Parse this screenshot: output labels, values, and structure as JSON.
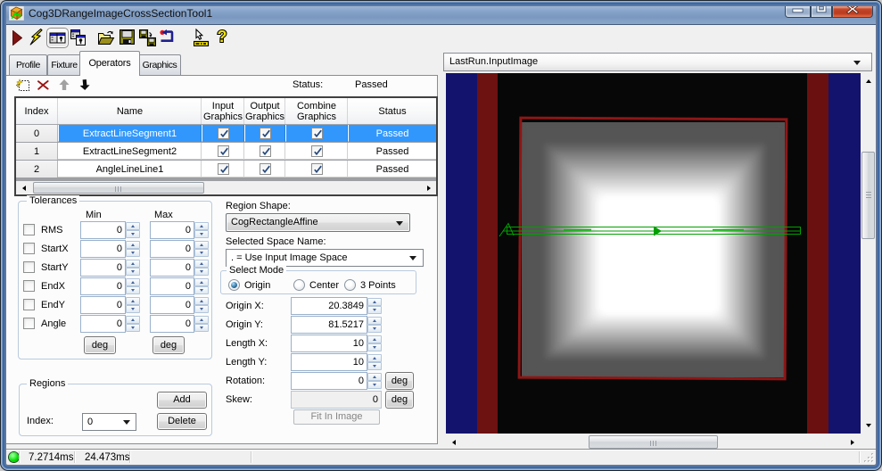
{
  "window": {
    "title": "Cog3DRangeImageCrossSectionTool1"
  },
  "titlebar": {
    "buttons": [
      "minimize",
      "maximize",
      "close"
    ]
  },
  "toolbar": {
    "icons": [
      "run-tool",
      "electric-run",
      "show-image-and-controls-toggle",
      "float-controls",
      "open-file",
      "save-file",
      "save-cross-section",
      "reset-tool",
      "electric-pointer",
      "help"
    ]
  },
  "tabs": {
    "items": [
      {
        "label": "Profile"
      },
      {
        "label": "Fixture"
      },
      {
        "label": "Operators"
      },
      {
        "label": "Graphics"
      }
    ],
    "active": "Operators"
  },
  "operators": {
    "icons": [
      "new-operator",
      "delete-operator",
      "move-up",
      "move-down"
    ],
    "status_label": "Status:",
    "status_value": "Passed"
  },
  "table": {
    "columns": [
      "Index",
      "Name",
      "Input Graphics",
      "Output Graphics",
      "Combine Graphics",
      "Status"
    ],
    "rows": [
      {
        "index": "0",
        "name": "ExtractLineSegment1",
        "input_graphics": true,
        "output_graphics": true,
        "combine_graphics": true,
        "status": "Passed",
        "selected": true
      },
      {
        "index": "1",
        "name": "ExtractLineSegment2",
        "input_graphics": true,
        "output_graphics": true,
        "combine_graphics": true,
        "status": "Passed",
        "selected": false
      },
      {
        "index": "2",
        "name": "AngleLineLine1",
        "input_graphics": true,
        "output_graphics": true,
        "combine_graphics": true,
        "status": "Passed",
        "selected": false
      }
    ]
  },
  "tolerances": {
    "title": "Tolerances",
    "min_header": "Min",
    "max_header": "Max",
    "deg_label": "deg",
    "rows": [
      {
        "label": "RMS",
        "min": "0",
        "max": "0",
        "checked": false
      },
      {
        "label": "StartX",
        "min": "0",
        "max": "0",
        "checked": false
      },
      {
        "label": "StartY",
        "min": "0",
        "max": "0",
        "checked": false
      },
      {
        "label": "EndX",
        "min": "0",
        "max": "0",
        "checked": false
      },
      {
        "label": "EndY",
        "min": "0",
        "max": "0",
        "checked": false
      },
      {
        "label": "Angle",
        "min": "0",
        "max": "0",
        "checked": false
      }
    ]
  },
  "regions": {
    "title": "Regions",
    "add_label": "Add",
    "delete_label": "Delete",
    "index_label": "Index:",
    "index_value": "0"
  },
  "region_shape": {
    "label": "Region Shape:",
    "value": "CogRectangleAffine"
  },
  "selected_space": {
    "label": "Selected Space Name:",
    "value": ". = Use Input Image Space"
  },
  "select_mode": {
    "title": "Select Mode",
    "options": [
      {
        "label": "Origin",
        "selected": true
      },
      {
        "label": "Center",
        "selected": false
      },
      {
        "label": "3 Points",
        "selected": false
      }
    ]
  },
  "fields": [
    {
      "label": "Origin X:",
      "value": "20.3849"
    },
    {
      "label": "Origin Y:",
      "value": "81.5217"
    },
    {
      "label": "Length X:",
      "value": "10"
    },
    {
      "label": "Length Y:",
      "value": "10"
    },
    {
      "label": "Rotation:",
      "value": "0",
      "unit_button": "deg"
    },
    {
      "label": "Skew:",
      "value": "0",
      "unit_button": "deg",
      "disabled": true
    }
  ],
  "fit_button_label": "Fit In Image",
  "display": {
    "selector_value": "LastRun.InputImage"
  },
  "statusbar": {
    "time1": "7.2714ms",
    "time2": "24.473ms"
  },
  "colors": {
    "selection": "#3297fd",
    "titlebar_blue": "#7e9cc4",
    "image_stripe_blue": "#13136d",
    "image_stripe_red": "#6d1111",
    "region_outline_red": "#8d1616",
    "graphic_green": "#00a000",
    "led_green": "#00dd00"
  }
}
